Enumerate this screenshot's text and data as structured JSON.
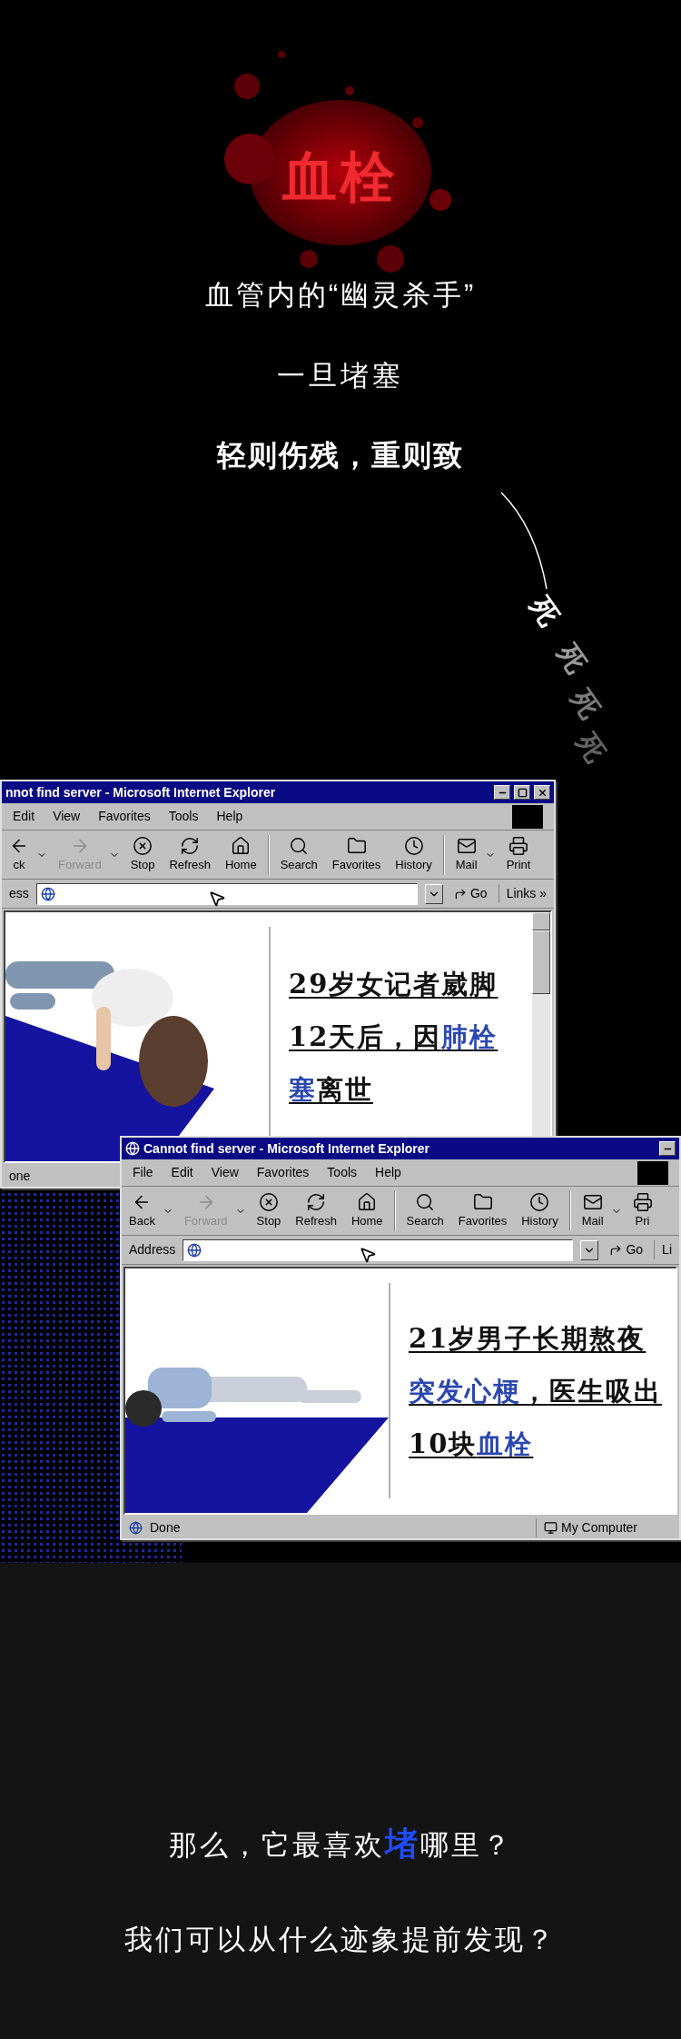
{
  "intro": {
    "title": "血栓",
    "subtitle": "血管内的“幽灵杀手”",
    "line": "一旦堵塞",
    "emphasis": "轻则伤残，重则致",
    "echo": [
      "死",
      "死",
      "死",
      "死"
    ]
  },
  "windows": [
    {
      "title": "nnot find server - Microsoft Internet Explorer",
      "title_icon": false,
      "title_buttons": [
        {
          "kind": "minimize"
        },
        {
          "kind": "maximize"
        },
        {
          "kind": "close"
        }
      ],
      "menu": [
        "Edit",
        "View",
        "Favorites",
        "Tools",
        "Help"
      ],
      "toolbar": [
        {
          "label": "ck",
          "kind": "back",
          "disabled": false,
          "dropdown": true
        },
        {
          "label": "Forward",
          "kind": "forward",
          "disabled": true,
          "dropdown": true
        },
        {
          "label": "Stop",
          "kind": "stop",
          "disabled": false,
          "dropdown": false
        },
        {
          "label": "Refresh",
          "kind": "refresh",
          "disabled": false,
          "dropdown": false
        },
        {
          "label": "Home",
          "kind": "home",
          "disabled": false,
          "dropdown": false
        },
        {
          "label": "Search",
          "kind": "search",
          "disabled": false,
          "dropdown": false
        },
        {
          "label": "Favorites",
          "kind": "favorites",
          "disabled": false,
          "dropdown": false
        },
        {
          "label": "History",
          "kind": "history",
          "disabled": false,
          "dropdown": false
        },
        {
          "label": "Mail",
          "kind": "mail",
          "disabled": false,
          "dropdown": true
        },
        {
          "label": "Print",
          "kind": "print",
          "disabled": false,
          "dropdown": false
        }
      ],
      "address_label": "ess",
      "go": "Go",
      "links": "Links »",
      "scrollbar": true,
      "headline": [
        {
          "text": "29岁女记者崴脚12天后，因",
          "kind": "plain"
        },
        {
          "text": "肺栓塞",
          "kind": "link"
        },
        {
          "text": "离世",
          "kind": "plain"
        }
      ],
      "status": "one"
    },
    {
      "title": "Cannot find server - Microsoft Internet Explorer",
      "title_icon": true,
      "title_buttons": [
        {
          "kind": "minimize"
        }
      ],
      "menu": [
        "File",
        "Edit",
        "View",
        "Favorites",
        "Tools",
        "Help"
      ],
      "toolbar": [
        {
          "label": "Back",
          "kind": "back",
          "disabled": false,
          "dropdown": true
        },
        {
          "label": "Forward",
          "kind": "forward",
          "disabled": true,
          "dropdown": true
        },
        {
          "label": "Stop",
          "kind": "stop",
          "disabled": false,
          "dropdown": false
        },
        {
          "label": "Refresh",
          "kind": "refresh",
          "disabled": false,
          "dropdown": false
        },
        {
          "label": "Home",
          "kind": "home",
          "disabled": false,
          "dropdown": false
        },
        {
          "label": "Search",
          "kind": "search",
          "disabled": false,
          "dropdown": false
        },
        {
          "label": "Favorites",
          "kind": "favorites",
          "disabled": false,
          "dropdown": false
        },
        {
          "label": "History",
          "kind": "history",
          "disabled": false,
          "dropdown": false
        },
        {
          "label": "Mail",
          "kind": "mail",
          "disabled": false,
          "dropdown": true
        },
        {
          "label": "Pri",
          "kind": "print",
          "disabled": false,
          "dropdown": false
        }
      ],
      "address_label": "Address",
      "go": "Go",
      "links": "Li",
      "scrollbar": false,
      "headline": [
        {
          "text": "21岁男子长期熬夜",
          "kind": "plain"
        },
        {
          "text": "突发心梗",
          "kind": "link"
        },
        {
          "text": "，医生吸出10块",
          "kind": "plain"
        },
        {
          "text": "血栓",
          "kind": "link"
        }
      ],
      "status": "Done",
      "status_zone": "My Computer"
    }
  ],
  "closing": {
    "question": [
      {
        "text": "那么，它最喜欢",
        "kind": "plain"
      },
      {
        "text": "堵",
        "kind": "highlight"
      },
      {
        "text": "哪里？",
        "kind": "plain"
      }
    ],
    "followup": "我们可以从什么迹象提前发现？"
  }
}
